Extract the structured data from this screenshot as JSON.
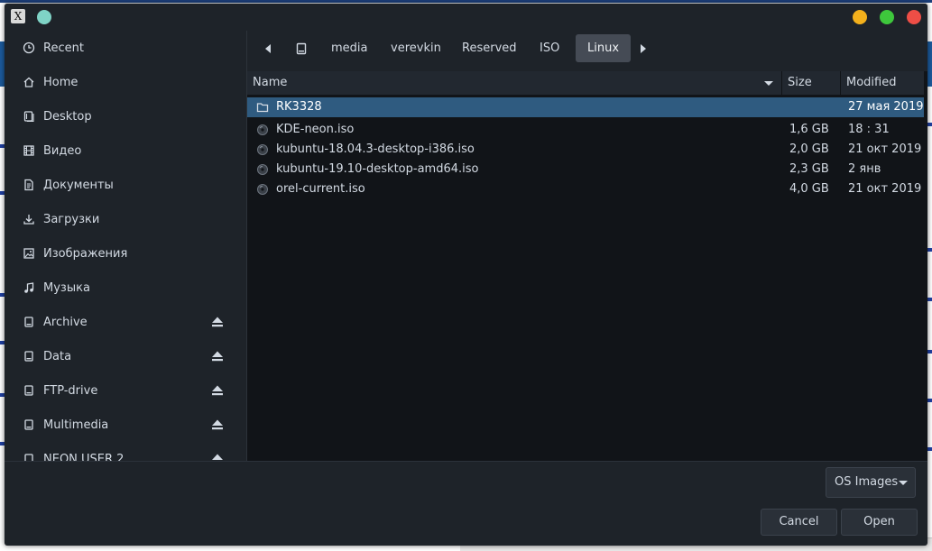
{
  "window": {
    "app_icon": "x-window-icon",
    "buttons": [
      "minimize",
      "maximize",
      "close"
    ],
    "colors": {
      "minimize": "#f3b01c",
      "maximize": "#3ec73c",
      "close": "#ee4e46"
    }
  },
  "sidebar": {
    "items": [
      {
        "label": "Recent",
        "icon": "clock-icon",
        "eject": false
      },
      {
        "label": "Home",
        "icon": "home-icon",
        "eject": false
      },
      {
        "label": "Desktop",
        "icon": "desktop-icon",
        "eject": false
      },
      {
        "label": "Видео",
        "icon": "film-icon",
        "eject": false
      },
      {
        "label": "Документы",
        "icon": "document-icon",
        "eject": false
      },
      {
        "label": "Загрузки",
        "icon": "download-icon",
        "eject": false
      },
      {
        "label": "Изображения",
        "icon": "image-icon",
        "eject": false
      },
      {
        "label": "Музыка",
        "icon": "music-icon",
        "eject": false
      },
      {
        "label": "Archive",
        "icon": "drive-icon",
        "eject": true
      },
      {
        "label": "Data",
        "icon": "drive-icon",
        "eject": true
      },
      {
        "label": "FTP-drive",
        "icon": "drive-icon",
        "eject": true
      },
      {
        "label": "Multimedia",
        "icon": "drive-icon",
        "eject": true
      },
      {
        "label": "NEON USER 2",
        "icon": "drive-icon",
        "eject": true
      }
    ]
  },
  "pathbar": {
    "crumbs": [
      "media",
      "verevkin",
      "Reserved",
      "ISO",
      "Linux"
    ],
    "active": "Linux"
  },
  "filelist": {
    "headers": {
      "name": "Name",
      "size": "Size",
      "modified": "Modified"
    },
    "rows": [
      {
        "name": "RK3328",
        "size": "",
        "modified": "27 мая 2019",
        "type": "folder",
        "selected": true
      },
      {
        "name": "KDE-neon.iso",
        "size": "1,6 GB",
        "modified": "18 : 31",
        "type": "disc",
        "selected": false
      },
      {
        "name": "kubuntu-18.04.3-desktop-i386.iso",
        "size": "2,0 GB",
        "modified": "21 окт 2019",
        "type": "disc",
        "selected": false
      },
      {
        "name": "kubuntu-19.10-desktop-amd64.iso",
        "size": "2,3 GB",
        "modified": "2 янв",
        "type": "disc",
        "selected": false
      },
      {
        "name": "orel-current.iso",
        "size": "4,0 GB",
        "modified": "21 окт 2019",
        "type": "disc",
        "selected": false
      }
    ]
  },
  "footer": {
    "filter": "OS Images",
    "cancel": "Cancel",
    "open": "Open"
  }
}
